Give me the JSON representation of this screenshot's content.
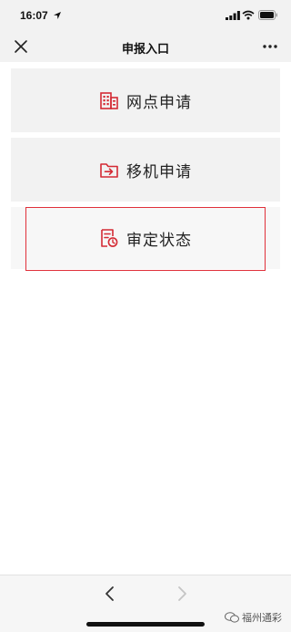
{
  "status_bar": {
    "time": "16:07",
    "icons": [
      "location-arrow-icon",
      "signal-icon",
      "wifi-icon",
      "battery-icon"
    ]
  },
  "nav": {
    "title": "申报入口",
    "close_icon": "close-icon",
    "more_icon": "more-dots-icon"
  },
  "menu": {
    "items": [
      {
        "label": "网点申请",
        "icon": "building-icon"
      },
      {
        "label": "移机申请",
        "icon": "folder-transfer-icon"
      },
      {
        "label": "审定状态",
        "icon": "document-clock-icon",
        "selected": true
      }
    ]
  },
  "bottom": {
    "back_icon": "chevron-left-icon",
    "forward_icon": "chevron-right-icon",
    "watermark": "福州通彩"
  },
  "colors": {
    "accent": "#e0303a",
    "card_bg": "#f2f2f2",
    "bar_bg": "#f2f2f2"
  }
}
